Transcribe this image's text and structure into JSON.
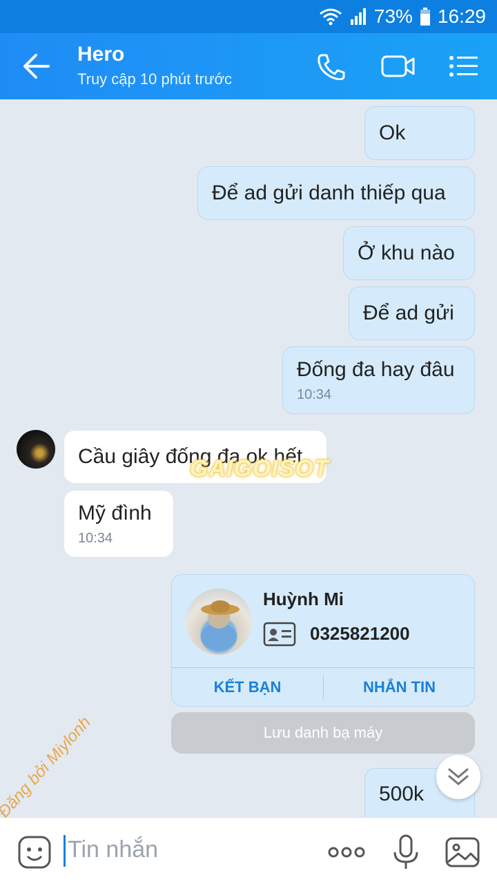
{
  "status_bar": {
    "battery": "73%",
    "time": "16:29"
  },
  "header": {
    "title": "Hero",
    "subtitle": "Truy cập 10 phút trước",
    "icons": [
      "back-arrow-icon",
      "phone-icon",
      "video-call-icon",
      "menu-list-icon"
    ]
  },
  "messages": [
    {
      "dir": "out",
      "text": "Ok"
    },
    {
      "dir": "out",
      "text": "Để ad gửi danh thiếp qua"
    },
    {
      "dir": "out",
      "text": "Ở khu nào"
    },
    {
      "dir": "out",
      "text": "Để ad gửi"
    },
    {
      "dir": "out",
      "text": "Đống đa hay đâu",
      "time": "10:34"
    },
    {
      "dir": "in",
      "text": "Cầu giây đống đa ok hết"
    },
    {
      "dir": "in",
      "text": "Mỹ đình",
      "time": "10:34"
    },
    {
      "dir": "out",
      "text": "500k"
    }
  ],
  "contact_card": {
    "name": "Huỳnh Mi",
    "phone": "0325821200",
    "add_friend_label": "KẾT BẠN",
    "message_label": "NHẮN TIN",
    "save_contact_label": "Lưu danh bạ máy"
  },
  "watermark": "GAIGOISOT",
  "signature": "Đăng bởi Miylonh",
  "input": {
    "placeholder": "Tin nhắn"
  },
  "colors": {
    "header": "#1f8cf5",
    "outgoing": "#d5ebfb",
    "incoming": "#ffffff",
    "accent": "#1a7fd8"
  }
}
